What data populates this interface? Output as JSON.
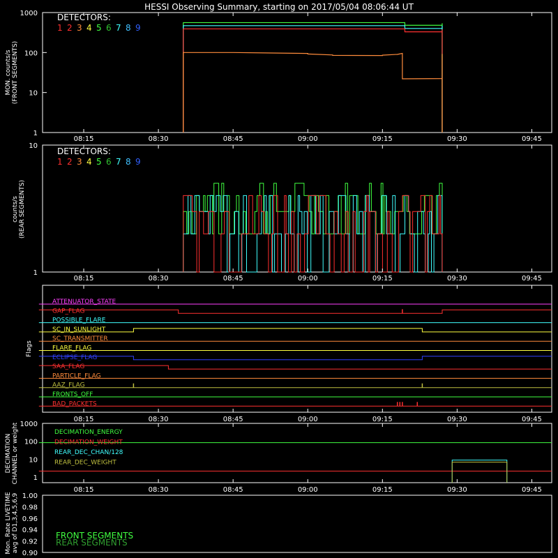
{
  "title": "HESSI Observing Summary, starting on 2017/05/04 08:06:44 UT",
  "time_ticks": [
    "08:15",
    "08:30",
    "08:45",
    "09:00",
    "09:15",
    "09:30",
    "09:45"
  ],
  "detector_colors": [
    "#ff3030",
    "#ff3030",
    "#ff8c3c",
    "#ffff40",
    "#40ff40",
    "#30c030",
    "#40ffff",
    "#40c0ff",
    "#3060ff"
  ],
  "chart_data": [
    {
      "type": "line",
      "panel": "front",
      "ylabel": [
        "MON. counts/s",
        "(FRONT SEGMENTS)"
      ],
      "yscale": "log",
      "ylim": [
        1,
        1000
      ],
      "yticks": [
        "1",
        "10",
        "100",
        "1000"
      ],
      "legend_title": "DETECTORS:",
      "legend_items": [
        "1",
        "2",
        "3",
        "4",
        "5",
        "6",
        "7",
        "8",
        "9"
      ],
      "series": [
        {
          "color": "#40ff40",
          "t": [
            "08:35",
            "09:19",
            "09:19.5",
            "09:27"
          ],
          "values": [
            560,
            560,
            480,
            540
          ]
        },
        {
          "color": "#40ffff",
          "t": [
            "08:35",
            "09:19",
            "09:19.5",
            "09:27"
          ],
          "values": [
            470,
            470,
            400,
            470
          ]
        },
        {
          "color": "#ff3030",
          "t": [
            "08:35",
            "09:19",
            "09:19.5",
            "09:27"
          ],
          "values": [
            390,
            390,
            330,
            380
          ]
        },
        {
          "color": "#ff8c3c",
          "t": [
            "08:35",
            "08:45",
            "09:00",
            "09:05",
            "09:15",
            "09:18",
            "09:19",
            "09:27"
          ],
          "values": [
            100,
            100,
            92,
            85,
            86,
            90,
            22,
            92
          ]
        }
      ]
    },
    {
      "type": "line",
      "panel": "rear",
      "ylabel": [
        "counts/s",
        "(REAR SEGMENTS)"
      ],
      "yscale": "log",
      "ylim": [
        1,
        10
      ],
      "yticks": [
        "1",
        "10"
      ],
      "legend_title": "DETECTORS:",
      "legend_items": [
        "1",
        "2",
        "3",
        "4",
        "5",
        "6",
        "7",
        "8",
        "9"
      ],
      "series_colors": [
        "#40ff40",
        "#40ffff",
        "#ff3030"
      ],
      "levels": [
        1,
        2,
        3,
        4,
        5
      ],
      "t_range": [
        "08:35",
        "09:27"
      ]
    },
    {
      "type": "flags",
      "ylabel": "Flags",
      "flags": [
        {
          "label": "ATTENUATOR_STATE",
          "color": "#ff40ff",
          "segments": [
            [
              "08:06",
              "09:49",
              0
            ]
          ]
        },
        {
          "label": "GAP_FLAG",
          "color": "#ff3030",
          "segments": [
            [
              "08:06",
              "08:34",
              1
            ],
            [
              "08:34",
              "09:27",
              0
            ],
            [
              "09:27",
              "09:49",
              1
            ]
          ],
          "spikes": [
            "09:19"
          ]
        },
        {
          "label": "POSSIBLE_FLARE",
          "color": "#40ffff",
          "segments": [
            [
              "08:06",
              "09:49",
              0
            ]
          ]
        },
        {
          "label": "SC_IN_SUNLIGHT",
          "color": "#ffff40",
          "segments": [
            [
              "08:06",
              "08:25",
              0
            ],
            [
              "08:25",
              "09:23",
              1
            ],
            [
              "09:23",
              "09:49",
              0
            ]
          ]
        },
        {
          "label": "SC_TRANSMITTER",
          "color": "#ff8c3c",
          "segments": [
            [
              "08:06",
              "09:49",
              0
            ]
          ]
        },
        {
          "label": "FLARE_FLAG",
          "color": "#ffff40",
          "segments": [
            [
              "08:06",
              "09:49",
              0
            ]
          ]
        },
        {
          "label": "ECLIPSE_FLAG",
          "color": "#3040ff",
          "segments": [
            [
              "08:06",
              "08:25",
              1
            ],
            [
              "08:25",
              "09:23",
              0
            ],
            [
              "09:23",
              "09:49",
              1
            ]
          ]
        },
        {
          "label": "SAA_FLAG",
          "color": "#ff3030",
          "segments": [
            [
              "08:06",
              "08:32",
              1
            ],
            [
              "08:32",
              "09:49",
              0
            ]
          ]
        },
        {
          "label": "PARTICLE_FLAG",
          "color": "#ff8c3c",
          "segments": [
            [
              "08:06",
              "09:49",
              0
            ]
          ]
        },
        {
          "label": "AAZ_FLAG",
          "color": "#c0c040",
          "segments": [
            [
              "08:06",
              "09:49",
              0
            ]
          ],
          "spikes": [
            "08:25",
            "09:23"
          ]
        },
        {
          "label": "FRONTS_OFF",
          "color": "#40ff40",
          "segments": [
            [
              "08:06",
              "09:49",
              0
            ]
          ]
        },
        {
          "label": "BAD_PACKETS",
          "color": "#ff3030",
          "segments": [
            [
              "08:06",
              "09:49",
              0
            ]
          ],
          "spikes": [
            "09:18",
            "09:18.5",
            "09:19",
            "09:22"
          ]
        }
      ]
    },
    {
      "type": "line",
      "panel": "decimation",
      "ylabel": [
        "DECIMATION",
        "CHANNEL or weight"
      ],
      "yscale": "log",
      "ylim": [
        0.5,
        1000
      ],
      "yticks": [
        "1",
        "10",
        "100",
        "1000"
      ],
      "legend_items": [
        "DECIMATION_ENERGY",
        "DECIMATION_WEIGHT",
        "REAR_DEC_CHAN/128",
        "REAR_DEC_WEIGHT"
      ],
      "series": [
        {
          "name": "DECIMATION_ENERGY",
          "color": "#40ff40",
          "t": [
            "08:06",
            "09:49"
          ],
          "values": [
            85,
            85
          ]
        },
        {
          "name": "DECIMATION_WEIGHT",
          "color": "#ff3030",
          "t": [
            "08:06",
            "09:49"
          ],
          "values": [
            2.2,
            2.2
          ]
        },
        {
          "name": "REAR_DEC_CHAN/128",
          "color": "#40ffff",
          "t": [
            "09:29",
            "09:40"
          ],
          "values": [
            9,
            9
          ]
        },
        {
          "name": "REAR_DEC_WEIGHT",
          "color": "#c0c040",
          "t": [
            "09:29",
            "09:40"
          ],
          "values": [
            7,
            7
          ]
        }
      ]
    },
    {
      "type": "line",
      "panel": "livetime",
      "ylabel": [
        "Mon. Rate LIVETIME",
        "avg of D1,3,4,5,6,9"
      ],
      "ylim": [
        0.9,
        1.0
      ],
      "yticks": [
        "0.90",
        "0.92",
        "0.94",
        "0.96",
        "0.98",
        "1.00"
      ],
      "legend_items": [
        "FRONT SEGMENTS",
        "REAR SEGMENTS"
      ],
      "legend_colors": [
        "#40ff40",
        "#30a030"
      ]
    }
  ]
}
